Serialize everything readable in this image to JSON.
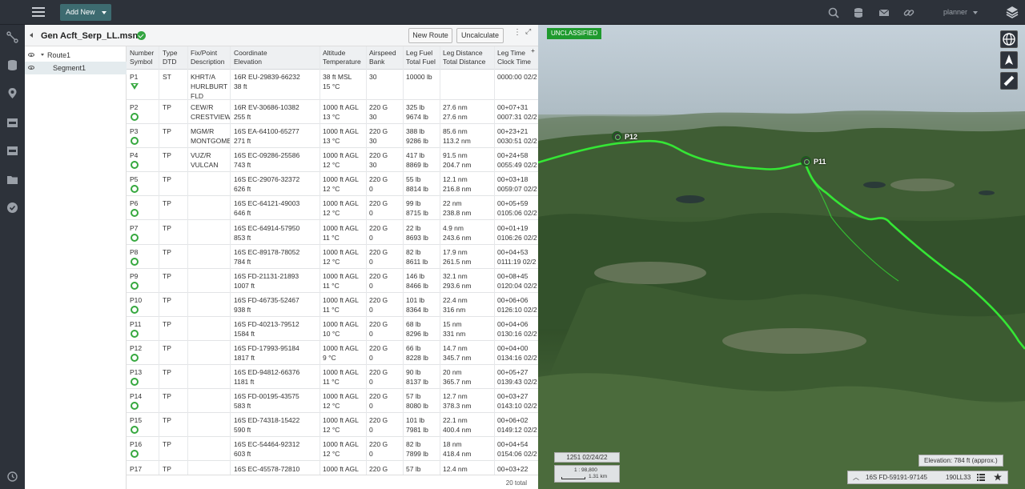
{
  "topbar": {
    "add_new_label": "Add New",
    "user_label": "planner"
  },
  "panel": {
    "title": "Gen Acft_Serp_LL.msnx",
    "new_route_label": "New Route",
    "uncalculate_label": "Uncalculate",
    "kebab_label": "⋮",
    "expand_label": "⤢"
  },
  "tree": {
    "route_label": "Route1",
    "segment_label": "Segment1"
  },
  "grid": {
    "headers": {
      "number_symbol": [
        "Number",
        "Symbol"
      ],
      "type_dtd": [
        "Type",
        "DTD"
      ],
      "fix_point": [
        "Fix/Point",
        "Description"
      ],
      "coord_elev": [
        "Coordinate",
        "Elevation"
      ],
      "alt_temp": [
        "Altitude",
        "Temperature"
      ],
      "airspeed_bank": [
        "Airspeed",
        "Bank"
      ],
      "fuel": [
        "Leg Fuel",
        "Total Fuel"
      ],
      "distance": [
        "Leg Distance",
        "Total Distance"
      ],
      "time": [
        "Leg Time",
        "Clock Time"
      ]
    },
    "rows": [
      {
        "num": "P1",
        "type": "ST",
        "fix1": "KHRT/A",
        "fix2": "HURLBURT",
        "fix3": "FLD",
        "coord": "16R EU-29839-66232",
        "elev": "38 ft",
        "alt": "38 ft MSL",
        "temp": "15 °C",
        "speed": "",
        "bank": "30",
        "legfuel": "",
        "totfuel": "10000 lb",
        "legdist": "",
        "totdist": "",
        "legtime": "",
        "clock": "0000:00 02/2"
      },
      {
        "num": "P2",
        "type": "TP",
        "fix1": "CEW/R",
        "fix2": "CRESTVIEW",
        "fix3": "",
        "coord": "16R EV-30686-10382",
        "elev": "255 ft",
        "alt": "1000 ft AGL",
        "temp": "13 °C",
        "speed": "220 G",
        "bank": "30",
        "legfuel": "325 lb",
        "totfuel": "9674 lb",
        "legdist": "27.6 nm",
        "totdist": "27.6 nm",
        "legtime": "00+07+31",
        "clock": "0007:31 02/2"
      },
      {
        "num": "P3",
        "type": "TP",
        "fix1": "MGM/R",
        "fix2": "MONTGOME",
        "fix3": "",
        "coord": "16S EA-64100-65277",
        "elev": "271 ft",
        "alt": "1000 ft AGL",
        "temp": "13 °C",
        "speed": "220 G",
        "bank": "30",
        "legfuel": "388 lb",
        "totfuel": "9286 lb",
        "legdist": "85.6 nm",
        "totdist": "113.2 nm",
        "legtime": "00+23+21",
        "clock": "0030:51 02/2"
      },
      {
        "num": "P4",
        "type": "TP",
        "fix1": "VUZ/R",
        "fix2": "VULCAN",
        "fix3": "",
        "coord": "16S EC-09286-25586",
        "elev": "743 ft",
        "alt": "1000 ft AGL",
        "temp": "12 °C",
        "speed": "220 G",
        "bank": "30",
        "legfuel": "417 lb",
        "totfuel": "8869 lb",
        "legdist": "91.5 nm",
        "totdist": "204.7 nm",
        "legtime": "00+24+58",
        "clock": "0055:49 02/2"
      },
      {
        "num": "P5",
        "type": "TP",
        "fix1": "",
        "fix2": "",
        "fix3": "",
        "coord": "16S EC-29076-32372",
        "elev": "626 ft",
        "alt": "1000 ft AGL",
        "temp": "12 °C",
        "speed": "220 G",
        "bank": "0",
        "legfuel": "55 lb",
        "totfuel": "8814 lb",
        "legdist": "12.1 nm",
        "totdist": "216.8 nm",
        "legtime": "00+03+18",
        "clock": "0059:07 02/2"
      },
      {
        "num": "P6",
        "type": "TP",
        "fix1": "",
        "fix2": "",
        "fix3": "",
        "coord": "16S EC-64121-49003",
        "elev": "646 ft",
        "alt": "1000 ft AGL",
        "temp": "12 °C",
        "speed": "220 G",
        "bank": "0",
        "legfuel": "99 lb",
        "totfuel": "8715 lb",
        "legdist": "22 nm",
        "totdist": "238.8 nm",
        "legtime": "00+05+59",
        "clock": "0105:06 02/2"
      },
      {
        "num": "P7",
        "type": "TP",
        "fix1": "",
        "fix2": "",
        "fix3": "",
        "coord": "16S EC-64914-57950",
        "elev": "853 ft",
        "alt": "1000 ft AGL",
        "temp": "11 °C",
        "speed": "220 G",
        "bank": "0",
        "legfuel": "22 lb",
        "totfuel": "8693 lb",
        "legdist": "4.9 nm",
        "totdist": "243.6 nm",
        "legtime": "00+01+19",
        "clock": "0106:26 02/2"
      },
      {
        "num": "P8",
        "type": "TP",
        "fix1": "",
        "fix2": "",
        "fix3": "",
        "coord": "16S EC-89178-78052",
        "elev": "784 ft",
        "alt": "1000 ft AGL",
        "temp": "12 °C",
        "speed": "220 G",
        "bank": "0",
        "legfuel": "82 lb",
        "totfuel": "8611 lb",
        "legdist": "17.9 nm",
        "totdist": "261.5 nm",
        "legtime": "00+04+53",
        "clock": "0111:19 02/2"
      },
      {
        "num": "P9",
        "type": "TP",
        "fix1": "",
        "fix2": "",
        "fix3": "",
        "coord": "16S FD-21131-21893",
        "elev": "1007 ft",
        "alt": "1000 ft AGL",
        "temp": "11 °C",
        "speed": "220 G",
        "bank": "0",
        "legfuel": "146 lb",
        "totfuel": "8466 lb",
        "legdist": "32.1 nm",
        "totdist": "293.6 nm",
        "legtime": "00+08+45",
        "clock": "0120:04 02/2"
      },
      {
        "num": "P10",
        "type": "TP",
        "fix1": "",
        "fix2": "",
        "fix3": "",
        "coord": "16S FD-46735-52467",
        "elev": "938 ft",
        "alt": "1000 ft AGL",
        "temp": "11 °C",
        "speed": "220 G",
        "bank": "0",
        "legfuel": "101 lb",
        "totfuel": "8364 lb",
        "legdist": "22.4 nm",
        "totdist": "316 nm",
        "legtime": "00+06+06",
        "clock": "0126:10 02/2"
      },
      {
        "num": "P11",
        "type": "TP",
        "fix1": "",
        "fix2": "",
        "fix3": "",
        "coord": "16S FD-40213-79512",
        "elev": "1584 ft",
        "alt": "1000 ft AGL",
        "temp": "10 °C",
        "speed": "220 G",
        "bank": "0",
        "legfuel": "68 lb",
        "totfuel": "8296 lb",
        "legdist": "15 nm",
        "totdist": "331 nm",
        "legtime": "00+04+06",
        "clock": "0130:16 02/2"
      },
      {
        "num": "P12",
        "type": "TP",
        "fix1": "",
        "fix2": "",
        "fix3": "",
        "coord": "16S FD-17993-95184",
        "elev": "1817 ft",
        "alt": "1000 ft AGL",
        "temp": "9 °C",
        "speed": "220 G",
        "bank": "0",
        "legfuel": "66 lb",
        "totfuel": "8228 lb",
        "legdist": "14.7 nm",
        "totdist": "345.7 nm",
        "legtime": "00+04+00",
        "clock": "0134:16 02/2"
      },
      {
        "num": "P13",
        "type": "TP",
        "fix1": "",
        "fix2": "",
        "fix3": "",
        "coord": "16S ED-94812-66376",
        "elev": "1181 ft",
        "alt": "1000 ft AGL",
        "temp": "11 °C",
        "speed": "220 G",
        "bank": "0",
        "legfuel": "90 lb",
        "totfuel": "8137 lb",
        "legdist": "20 nm",
        "totdist": "365.7 nm",
        "legtime": "00+05+27",
        "clock": "0139:43 02/2"
      },
      {
        "num": "P14",
        "type": "TP",
        "fix1": "",
        "fix2": "",
        "fix3": "",
        "coord": "16S FD-00195-43575",
        "elev": "583 ft",
        "alt": "1000 ft AGL",
        "temp": "12 °C",
        "speed": "220 G",
        "bank": "0",
        "legfuel": "57 lb",
        "totfuel": "8080 lb",
        "legdist": "12.7 nm",
        "totdist": "378.3 nm",
        "legtime": "00+03+27",
        "clock": "0143:10 02/2"
      },
      {
        "num": "P15",
        "type": "TP",
        "fix1": "",
        "fix2": "",
        "fix3": "",
        "coord": "16S ED-74318-15422",
        "elev": "590 ft",
        "alt": "1000 ft AGL",
        "temp": "12 °C",
        "speed": "220 G",
        "bank": "0",
        "legfuel": "101 lb",
        "totfuel": "7981 lb",
        "legdist": "22.1 nm",
        "totdist": "400.4 nm",
        "legtime": "00+06+02",
        "clock": "0149:12 02/2"
      },
      {
        "num": "P16",
        "type": "TP",
        "fix1": "",
        "fix2": "",
        "fix3": "",
        "coord": "16S EC-54464-92312",
        "elev": "603 ft",
        "alt": "1000 ft AGL",
        "temp": "12 °C",
        "speed": "220 G",
        "bank": "0",
        "legfuel": "82 lb",
        "totfuel": "7899 lb",
        "legdist": "18 nm",
        "totdist": "418.4 nm",
        "legtime": "00+04+54",
        "clock": "0154:06 02/2"
      },
      {
        "num": "P17",
        "type": "TP",
        "fix1": "",
        "fix2": "",
        "fix3": "",
        "coord": "16S EC-45578-72810",
        "elev": "",
        "alt": "1000 ft AGL",
        "temp": "",
        "speed": "220 G",
        "bank": "",
        "legfuel": "57 lb",
        "totfuel": "",
        "legdist": "12.4 nm",
        "totdist": "",
        "legtime": "00+03+22",
        "clock": ""
      }
    ],
    "total_label": "20 total",
    "add_col": "+"
  },
  "map": {
    "classification": "UNCLASSIFIED",
    "wp_p12": "P12",
    "wp_p11": "P11",
    "time_label": "1251 02/24/22",
    "scale_ratio": "1 : 98,800",
    "scale_dist": "1.31 km",
    "elevation_label": "Elevation: 784 ft (approx.)",
    "coord_label": "16S FD-59191-97145",
    "alt_label": "190LL33",
    "route_color": "#35e635",
    "accent": "#1f9a2e"
  }
}
